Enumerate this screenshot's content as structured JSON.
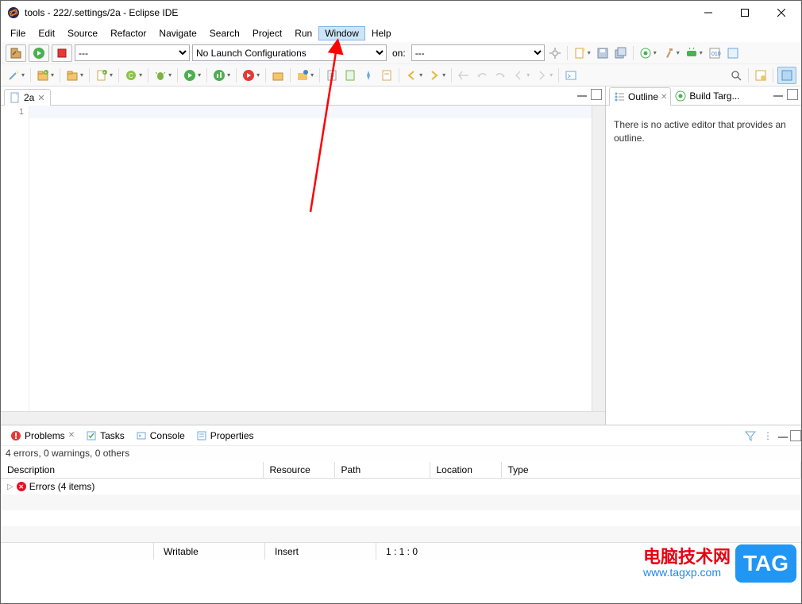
{
  "window": {
    "title": "tools - 222/.settings/2a - Eclipse IDE"
  },
  "menu": {
    "items": [
      "File",
      "Edit",
      "Source",
      "Refactor",
      "Navigate",
      "Search",
      "Project",
      "Run",
      "Window",
      "Help"
    ],
    "highlighted_index": 8
  },
  "toolbar1": {
    "combo1_value": "---",
    "launch_config_value": "No Launch Configurations",
    "on_label": "on:",
    "target_value": "---"
  },
  "editor": {
    "tab_name": "2a",
    "line_number": "1"
  },
  "outline": {
    "tab1": "Outline",
    "tab2": "Build Targ...",
    "message": "There is no active editor that provides an outline."
  },
  "bottom_tabs": {
    "problems": "Problems",
    "tasks": "Tasks",
    "console": "Console",
    "properties": "Properties"
  },
  "problems": {
    "summary": "4 errors, 0 warnings, 0 others",
    "columns": [
      "Description",
      "Resource",
      "Path",
      "Location",
      "Type"
    ],
    "row1": "Errors (4 items)"
  },
  "status": {
    "mode": "Writable",
    "insert": "Insert",
    "pos": "1 : 1 : 0"
  },
  "overlay": {
    "brand_cn": "电脑技术网",
    "brand_url": "www.tagxp.com",
    "tag": "TAG"
  }
}
